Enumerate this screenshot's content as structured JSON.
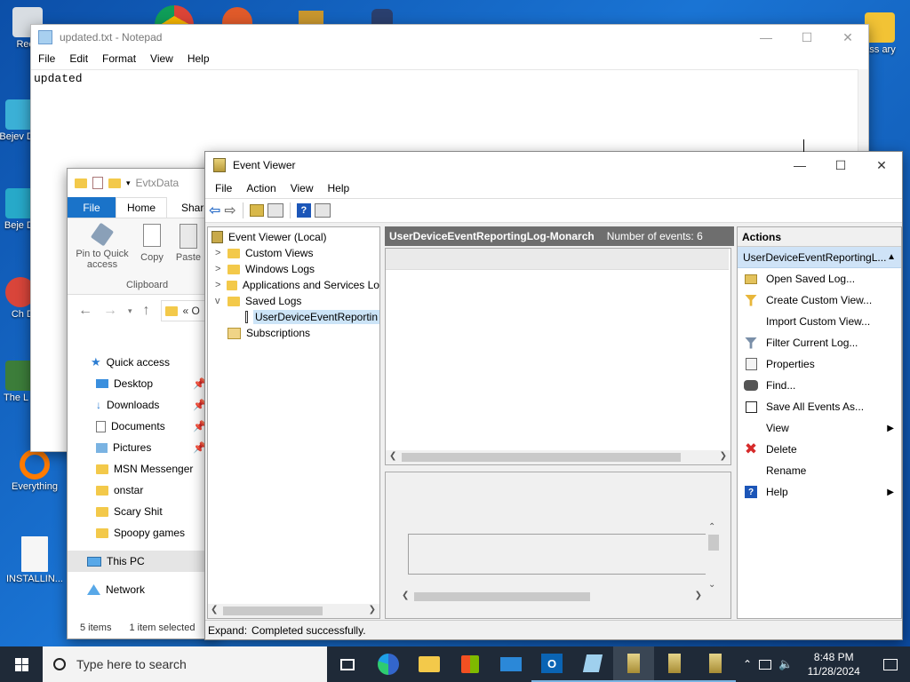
{
  "desktop": {
    "icons": [
      {
        "label": "Recy"
      },
      {
        "label": "Bejev De"
      },
      {
        "label": "Beje De"
      },
      {
        "label": "Ch De"
      },
      {
        "label": "The L of"
      },
      {
        "label": "Everything"
      },
      {
        "label": "INSTALLIN..."
      },
      {
        "label": "ass ary"
      }
    ]
  },
  "notepad": {
    "title": "updated.txt - Notepad",
    "menu": [
      "File",
      "Edit",
      "Format",
      "View",
      "Help"
    ],
    "content": "updated"
  },
  "explorer": {
    "path_fragment": "EvtxData",
    "ribbon_tabs": [
      "File",
      "Home",
      "Share"
    ],
    "pin_label": "Pin to Quick access",
    "copy_label": "Copy",
    "paste_label": "Paste",
    "group_label": "Clipboard",
    "address_text": "« O",
    "nav": [
      {
        "label": "Quick access",
        "icon": "star-icon"
      },
      {
        "label": "Desktop",
        "icon": "desktop-icon",
        "pinned": true
      },
      {
        "label": "Downloads",
        "icon": "download-icon",
        "pinned": true
      },
      {
        "label": "Documents",
        "icon": "documents-icon",
        "pinned": true
      },
      {
        "label": "Pictures",
        "icon": "pictures-icon",
        "pinned": true
      },
      {
        "label": "MSN Messenger",
        "icon": "folder-icon"
      },
      {
        "label": "onstar",
        "icon": "folder-icon"
      },
      {
        "label": "Scary Shit",
        "icon": "folder-icon"
      },
      {
        "label": "Spoopy games",
        "icon": "folder-icon"
      },
      {
        "label": "This PC",
        "icon": "computer-icon"
      },
      {
        "label": "Network",
        "icon": "network-icon"
      }
    ],
    "status_items": "5 items",
    "status_selected": "1 item selected"
  },
  "eventviewer": {
    "title": "Event Viewer",
    "menu": [
      "File",
      "Action",
      "View",
      "Help"
    ],
    "tree": [
      {
        "label": "Event Viewer (Local)",
        "level": 0,
        "arrow": ""
      },
      {
        "label": "Custom Views",
        "level": 1,
        "arrow": ">"
      },
      {
        "label": "Windows Logs",
        "level": 1,
        "arrow": ">"
      },
      {
        "label": "Applications and Services Lo",
        "level": 1,
        "arrow": ">"
      },
      {
        "label": "Saved Logs",
        "level": 1,
        "arrow": "v"
      },
      {
        "label": "UserDeviceEventReportin",
        "level": 2,
        "arrow": ""
      },
      {
        "label": "Subscriptions",
        "level": 1,
        "arrow": ""
      }
    ],
    "center_header_name": "UserDeviceEventReportingLog-Monarch",
    "center_header_count": "Number of events: 6",
    "actions_header": "Actions",
    "actions_subheader": "UserDeviceEventReportingL...",
    "actions": [
      {
        "label": "Open Saved Log...",
        "icon": "open-folder-icon",
        "submenu": false
      },
      {
        "label": "Create Custom View...",
        "icon": "funnel-icon",
        "submenu": false
      },
      {
        "label": "Import Custom View...",
        "icon": "",
        "submenu": false
      },
      {
        "label": "Filter Current Log...",
        "icon": "filter-icon",
        "submenu": false
      },
      {
        "label": "Properties",
        "icon": "properties-icon",
        "submenu": false
      },
      {
        "label": "Find...",
        "icon": "binoculars-icon",
        "submenu": false
      },
      {
        "label": "Save All Events As...",
        "icon": "save-icon",
        "submenu": false
      },
      {
        "label": "View",
        "icon": "",
        "submenu": true
      },
      {
        "label": "Delete",
        "icon": "delete-icon",
        "submenu": false
      },
      {
        "label": "Rename",
        "icon": "",
        "submenu": false
      },
      {
        "label": "Help",
        "icon": "help-icon",
        "submenu": true
      }
    ],
    "status_label": "Expand:",
    "status_text": "Completed successfully."
  },
  "taskbar": {
    "search_placeholder": "Type here to search",
    "time": "8:48 PM",
    "date": "11/28/2024"
  },
  "colors": {
    "accent": "#0078d7",
    "ev_header_bg": "#6e6e6e",
    "actions_selected": "#cfe3f7"
  }
}
